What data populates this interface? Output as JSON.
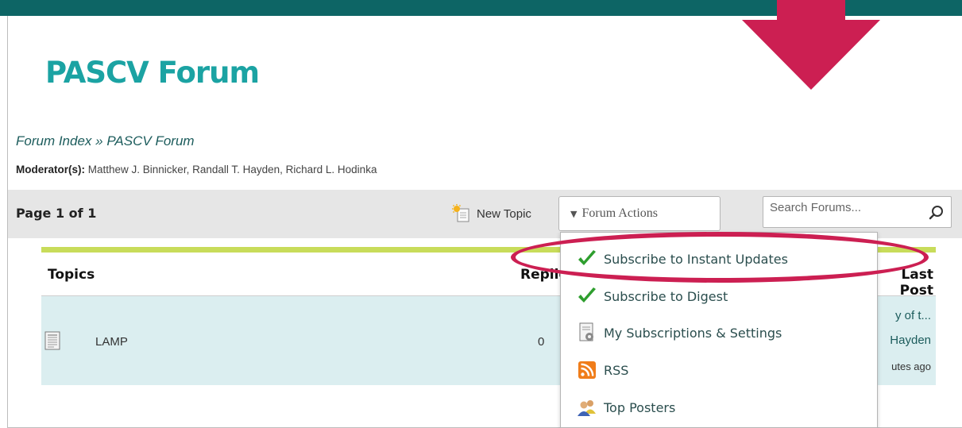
{
  "forum": {
    "title": "PASCV Forum",
    "breadcrumb": {
      "root": "Forum Index",
      "separator": " » ",
      "current": "PASCV Forum"
    },
    "moderators_label": "Moderator(s):",
    "moderators": "Matthew J. Binnicker, Randall T. Hayden, Richard L. Hodinka"
  },
  "toolbar": {
    "page_count": "Page 1 of 1",
    "new_topic_label": "New Topic",
    "new_topic_icon": "new-topic-sun-icon",
    "forum_actions_label": "Forum Actions",
    "search_placeholder": "Search Forums..."
  },
  "table": {
    "columns": {
      "topics": "Topics",
      "replies": "Replies",
      "last_post": "Last Post"
    },
    "rows": [
      {
        "icon": "document-icon",
        "name": "LAMP",
        "replies": "0",
        "last_post_title": "y of t...",
        "last_post_author": "Hayden",
        "last_post_time": "utes ago"
      }
    ]
  },
  "forum_actions_menu": {
    "items": [
      {
        "label": "Subscribe to Instant Updates",
        "icon": "checkmark-icon"
      },
      {
        "label": "Subscribe to Digest",
        "icon": "checkmark-icon"
      },
      {
        "label": "My Subscriptions & Settings",
        "icon": "settings-document-icon"
      },
      {
        "label": "RSS",
        "icon": "rss-icon"
      },
      {
        "label": "Top Posters",
        "icon": "people-icon"
      }
    ]
  },
  "colors": {
    "top_bar": "#0d6565",
    "title": "#1ba3a3",
    "accent_line": "#c8dc5a",
    "row_background": "#dbeef0",
    "annotation": "#cc1f52",
    "checkmark": "#2e9e2e",
    "rss": "#f07d1a"
  }
}
